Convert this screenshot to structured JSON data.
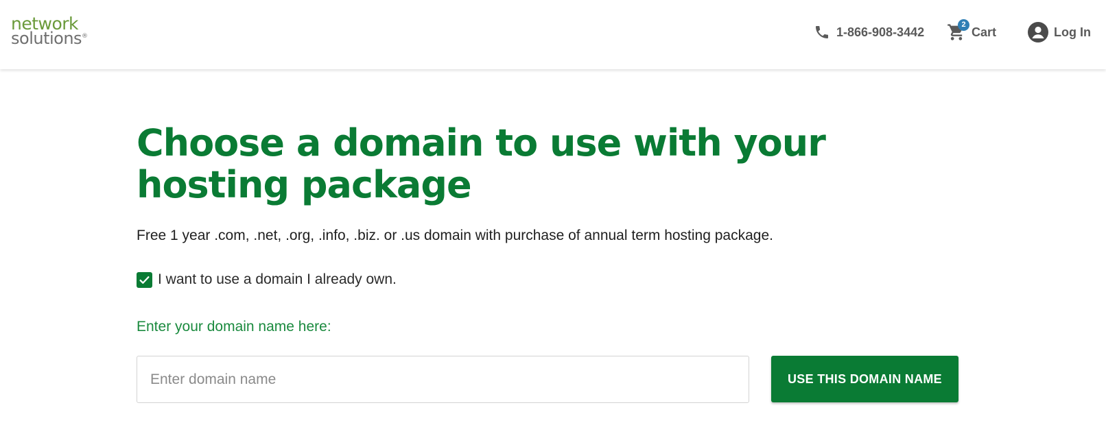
{
  "header": {
    "logo": {
      "line1": "network",
      "line2": "solutions",
      "mark": "®"
    },
    "phone": {
      "icon": "phone-icon",
      "label": "1-866-908-3442"
    },
    "cart": {
      "icon": "cart-icon",
      "label": "Cart",
      "count": "2"
    },
    "login": {
      "icon": "user-avatar-icon",
      "label": "Log In"
    }
  },
  "main": {
    "title": "Choose a domain to use with your hosting package",
    "promo": "Free 1 year .com, .net, .org, .info, .biz. or .us domain with purchase of annual term hosting package.",
    "own_domain_checkbox": {
      "label": "I want to use a domain I already own.",
      "checked": true
    },
    "domain_field": {
      "label": "Enter your domain name here:",
      "placeholder": "Enter domain name",
      "value": ""
    },
    "submit_label": "USE THIS DOMAIN NAME"
  },
  "colors": {
    "brand_green": "#0a7b34",
    "logo_green": "#6a9a3a",
    "badge_blue": "#2f7fb5"
  }
}
